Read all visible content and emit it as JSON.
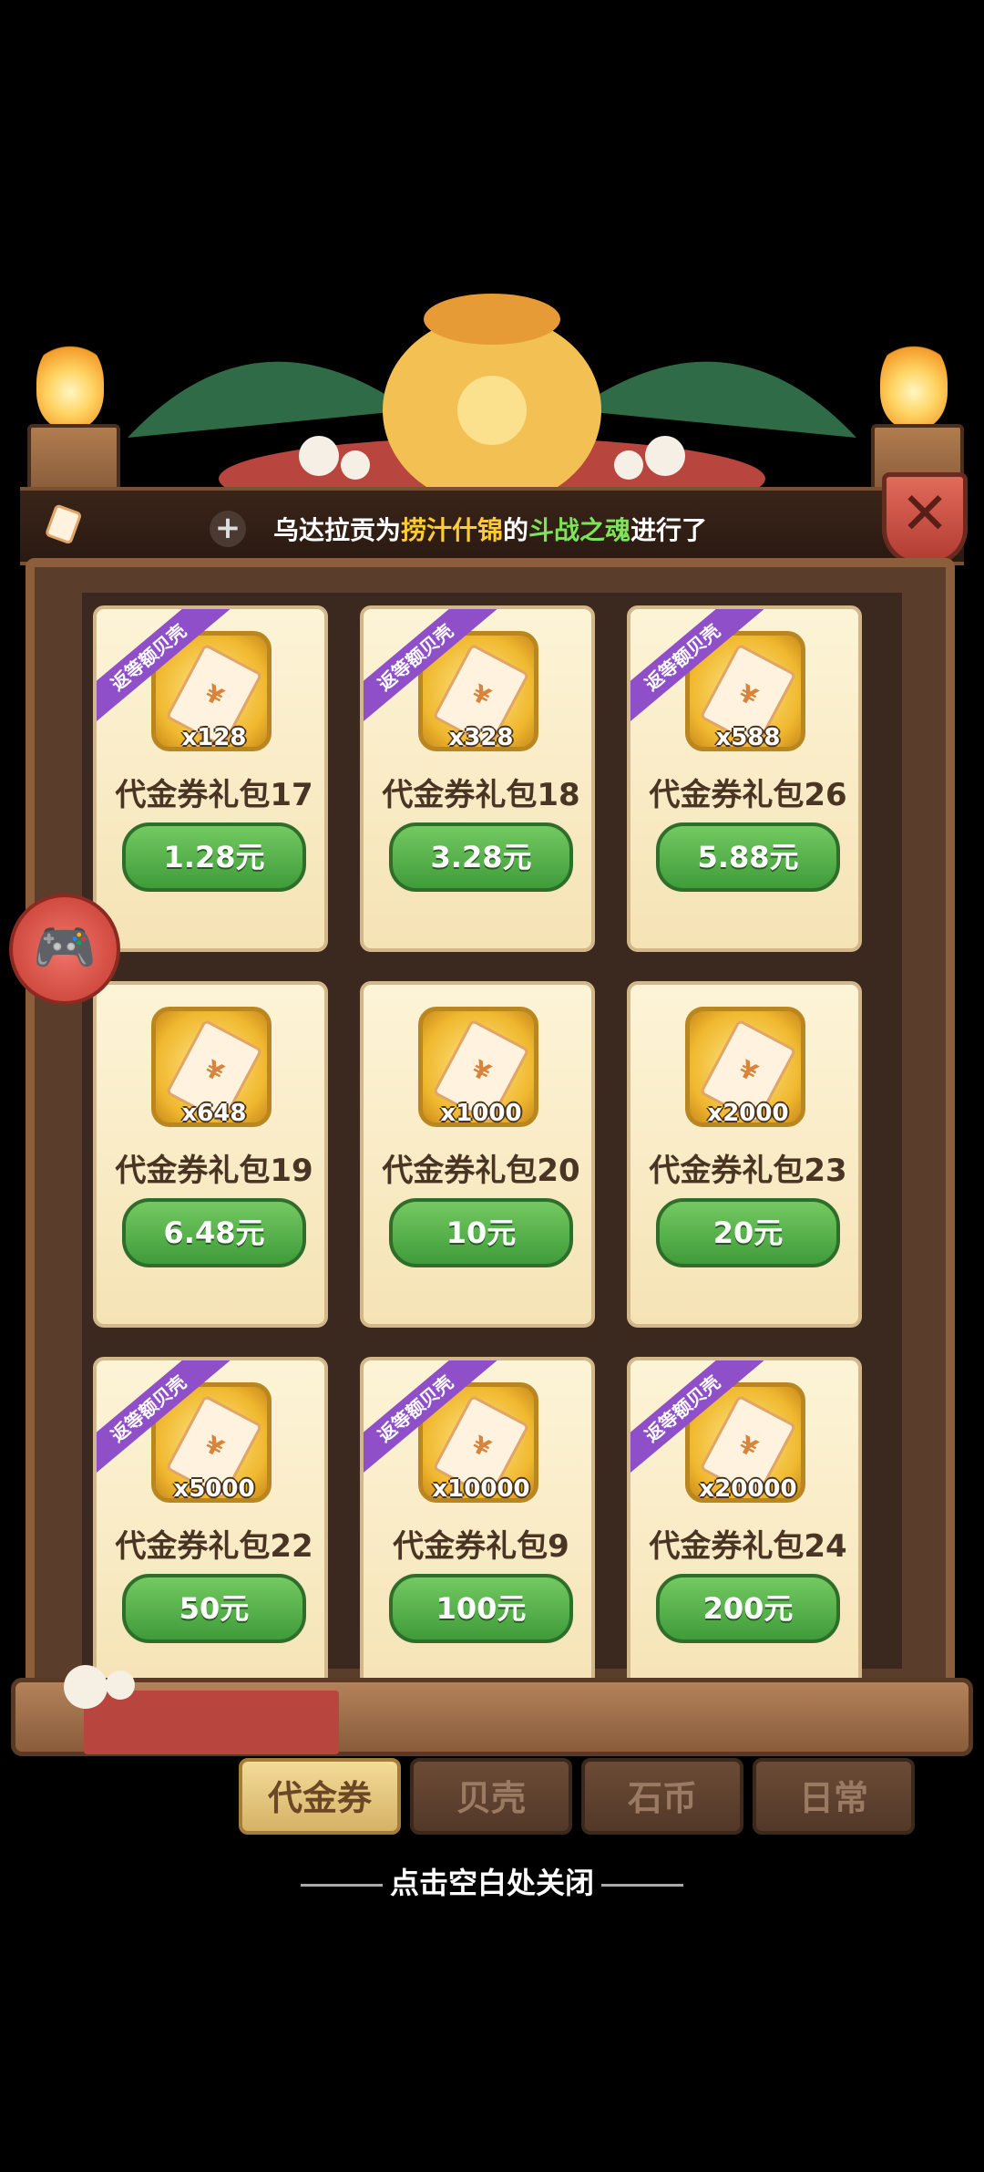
{
  "ticker": {
    "prefix": "乌达拉贡为",
    "item": "捞汁什锦",
    "middle": "的",
    "target": "斗战之魂",
    "suffix": "进行了"
  },
  "cards": [
    {
      "badge": "返等额贝壳",
      "qty": "x128",
      "name": "代金券礼包17",
      "price": "1.28元"
    },
    {
      "badge": "返等额贝壳",
      "qty": "x328",
      "name": "代金券礼包18",
      "price": "3.28元"
    },
    {
      "badge": "返等额贝壳",
      "qty": "x588",
      "name": "代金券礼包26",
      "price": "5.88元"
    },
    {
      "badge": "",
      "qty": "x648",
      "name": "代金券礼包19",
      "price": "6.48元"
    },
    {
      "badge": "",
      "qty": "x1000",
      "name": "代金券礼包20",
      "price": "10元"
    },
    {
      "badge": "",
      "qty": "x2000",
      "name": "代金券礼包23",
      "price": "20元"
    },
    {
      "badge": "返等额贝壳",
      "qty": "x5000",
      "name": "代金券礼包22",
      "price": "50元"
    },
    {
      "badge": "返等额贝壳",
      "qty": "x10000",
      "name": "代金券礼包9",
      "price": "100元"
    },
    {
      "badge": "返等额贝壳",
      "qty": "x20000",
      "name": "代金券礼包24",
      "price": "200元"
    }
  ],
  "tabs": [
    {
      "label": "代金券",
      "active": true
    },
    {
      "label": "贝壳",
      "active": false
    },
    {
      "label": "石币",
      "active": false
    },
    {
      "label": "日常",
      "active": false
    }
  ],
  "close_hint": "点击空白处关闭",
  "icons": {
    "ticket": "ticket-icon",
    "plus": "plus-icon",
    "close": "close-icon",
    "gamepad": "gamepad-icon"
  },
  "colors": {
    "price_button": "#4fae45",
    "badge": "#8e4fc9",
    "highlight_yellow": "#ffcc33",
    "highlight_green": "#7ee35a"
  }
}
